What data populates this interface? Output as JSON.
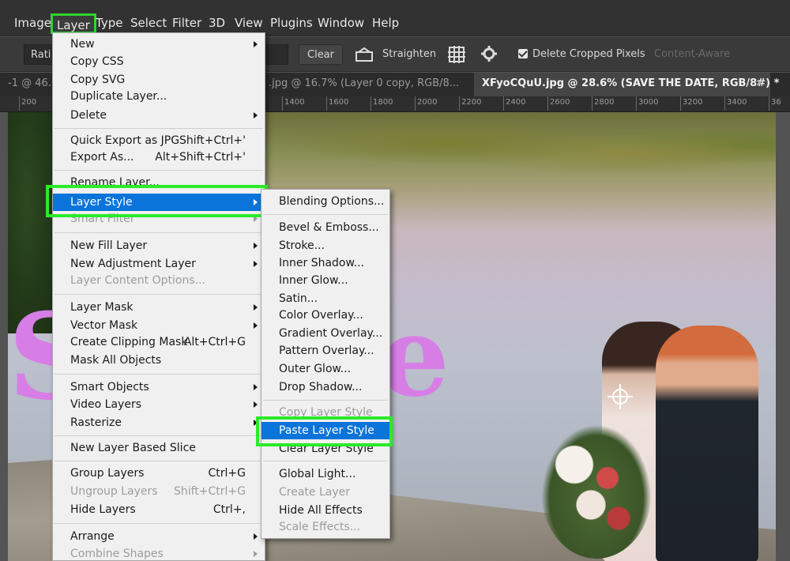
{
  "menubar": {
    "items": [
      "Image",
      "Layer",
      "Type",
      "Select",
      "Filter",
      "3D",
      "View",
      "Plugins",
      "Window",
      "Help"
    ]
  },
  "options": {
    "ratio_label": "Rati",
    "clear_label": "Clear",
    "straighten_label": "Straighten",
    "delete_cropped_label": "Delete Cropped Pixels",
    "content_aware_label": "Content-Aware"
  },
  "tabs": [
    {
      "label": "-1 @ 46."
    },
    {
      "label": ".jpg @ 16.7% (Layer 0 copy, RGB/8..."
    },
    {
      "label": "XFyoCQuU.jpg @ 28.6% (SAVE  THE  DATE, RGB/8#) *"
    }
  ],
  "tab_close": "×",
  "ruler": [
    "200",
    "1400",
    "1600",
    "1800",
    "2000",
    "2200",
    "2400",
    "2600",
    "2800",
    "3000",
    "3200",
    "3400",
    "36"
  ],
  "layer_menu": {
    "new": "New",
    "copy_css": "Copy CSS",
    "copy_svg": "Copy SVG",
    "duplicate": "Duplicate Layer...",
    "delete": "Delete",
    "quick_export": "Quick Export as JPG",
    "quick_export_sc": "Shift+Ctrl+'",
    "export_as": "Export As...",
    "export_as_sc": "Alt+Shift+Ctrl+'",
    "rename": "Rename Layer...",
    "layer_style": "Layer Style",
    "smart_filter": "Smart Filter",
    "new_fill": "New Fill Layer",
    "new_adjustment": "New Adjustment Layer",
    "layer_content_options": "Layer Content Options...",
    "layer_mask": "Layer Mask",
    "vector_mask": "Vector Mask",
    "clipping_mask": "Create Clipping Mask",
    "clipping_mask_sc": "Alt+Ctrl+G",
    "mask_all": "Mask All Objects",
    "smart_objects": "Smart Objects",
    "video_layers": "Video Layers",
    "rasterize": "Rasterize",
    "new_slice": "New Layer Based Slice",
    "group": "Group Layers",
    "group_sc": "Ctrl+G",
    "ungroup": "Ungroup Layers",
    "ungroup_sc": "Shift+Ctrl+G",
    "hide": "Hide Layers",
    "hide_sc": "Ctrl+,",
    "arrange": "Arrange",
    "combine": "Combine Shapes"
  },
  "style_menu": {
    "blending": "Blending Options...",
    "bevel": "Bevel & Emboss...",
    "stroke": "Stroke...",
    "inner_shadow": "Inner Shadow...",
    "inner_glow": "Inner Glow...",
    "satin": "Satin...",
    "color_overlay": "Color Overlay...",
    "gradient_overlay": "Gradient Overlay...",
    "pattern_overlay": "Pattern Overlay...",
    "outer_glow": "Outer Glow...",
    "drop_shadow": "Drop Shadow...",
    "copy_style": "Copy Layer Style",
    "paste_style": "Paste Layer Style",
    "clear_style": "Clear Layer Style",
    "global_light": "Global Light...",
    "create_layer": "Create Layer",
    "hide_effects": "Hide All Effects",
    "scale_effects": "Scale Effects..."
  },
  "colors": {
    "highlight_box": "#2bea2b",
    "menu_selection": "#0a74da",
    "decor_pink": "#d77ee6"
  },
  "icons": [
    "crop-straighten-icon",
    "grid-overlay-icon",
    "gear-icon",
    "crosshair-icon"
  ]
}
